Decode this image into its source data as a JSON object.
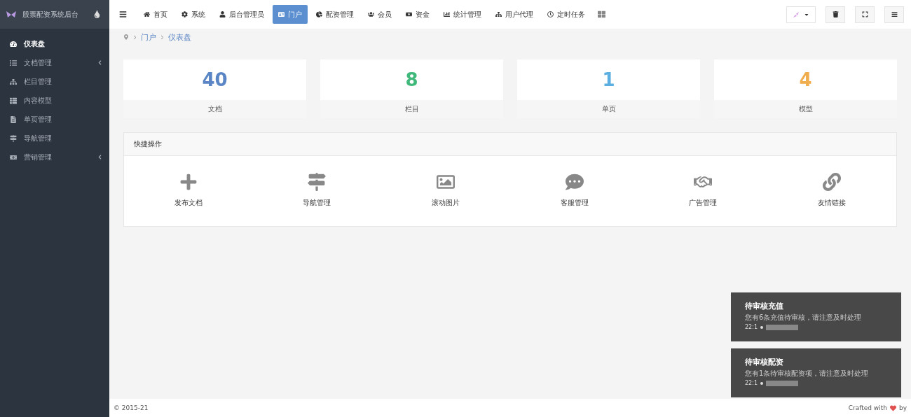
{
  "sidebar": {
    "title": "股票配资系统后台",
    "items": [
      {
        "label": "仪表盘",
        "selected": true,
        "expandable": false
      },
      {
        "label": "文档管理",
        "selected": false,
        "expandable": true
      },
      {
        "label": "栏目管理",
        "selected": false,
        "expandable": false
      },
      {
        "label": "内容模型",
        "selected": false,
        "expandable": false
      },
      {
        "label": "单页管理",
        "selected": false,
        "expandable": false
      },
      {
        "label": "导航管理",
        "selected": false,
        "expandable": false
      },
      {
        "label": "营销管理",
        "selected": false,
        "expandable": true
      }
    ]
  },
  "top_nav": [
    {
      "label": "首页",
      "selected": false
    },
    {
      "label": "系统",
      "selected": false
    },
    {
      "label": "后台管理员",
      "selected": false
    },
    {
      "label": "门户",
      "selected": true
    },
    {
      "label": "配资管理",
      "selected": false
    },
    {
      "label": "会员",
      "selected": false
    },
    {
      "label": "资金",
      "selected": false
    },
    {
      "label": "统计管理",
      "selected": false
    },
    {
      "label": "用户代理",
      "selected": false
    },
    {
      "label": "定时任务",
      "selected": false
    }
  ],
  "breadcrumb": [
    "门户",
    "仪表盘"
  ],
  "stats": [
    {
      "value": "40",
      "label": "文档",
      "color": "#5b86c5"
    },
    {
      "value": "8",
      "label": "栏目",
      "color": "#3fb87a"
    },
    {
      "value": "1",
      "label": "单页",
      "color": "#5aaee0"
    },
    {
      "value": "4",
      "label": "模型",
      "color": "#f0ad4e"
    }
  ],
  "quick": {
    "title": "快捷操作",
    "items": [
      "发布文档",
      "导航管理",
      "滚动图片",
      "客服管理",
      "广告管理",
      "友情链接"
    ]
  },
  "notifications": [
    {
      "title": "待审核充值",
      "message": "您有6条充值待审核，请注意及时处理",
      "time": "22:1"
    },
    {
      "title": "待审核配资",
      "message": "您有1条待审核配资项，请注意及时处理",
      "time": "22:1"
    }
  ],
  "footer": {
    "copyright": "© 2015-21",
    "credit_left": "Crafted with",
    "credit_right": "by"
  }
}
